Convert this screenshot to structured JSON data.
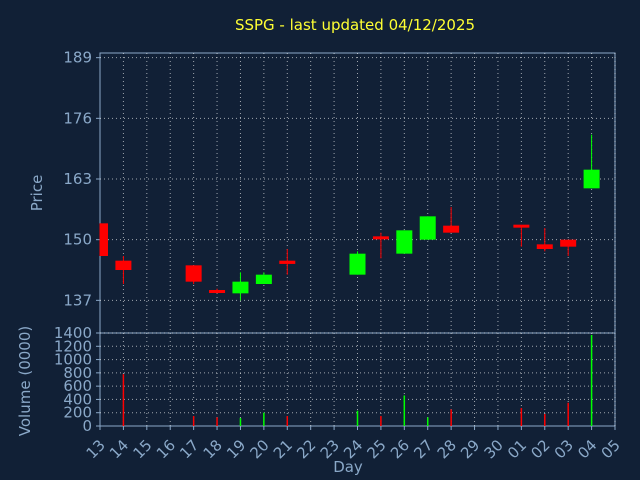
{
  "chart_data": {
    "type": "candlestick",
    "title": "SSPG - last updated 04/12/2025",
    "xlabel": "Day",
    "ylabel": "Price",
    "volume_label": "Volume (0000)",
    "price_ylim": [
      130,
      190
    ],
    "price_ticks": [
      137,
      150,
      163,
      176,
      189
    ],
    "volume_ylim": [
      0,
      1400
    ],
    "volume_ticks": [
      0,
      200,
      400,
      600,
      800,
      1000,
      1200,
      1400
    ],
    "x_ticks": [
      "13",
      "14",
      "15",
      "16",
      "17",
      "18",
      "19",
      "20",
      "21",
      "22",
      "23",
      "24",
      "25",
      "26",
      "27",
      "28",
      "29",
      "30",
      "01",
      "02",
      "03",
      "04",
      "05"
    ],
    "grid": true,
    "colors": {
      "background": "#112036",
      "title": "#ffff33",
      "axis_text": "#8aa8c8",
      "grid": "#ffffff",
      "up": "#00ff00",
      "down": "#ff0000"
    },
    "candles": [
      {
        "day": "13",
        "open": 153.5,
        "high": 153.5,
        "low": 146.5,
        "close": 146.5
      },
      {
        "day": "14",
        "open": 145.5,
        "high": 146.5,
        "low": 140.5,
        "close": 143.5
      },
      {
        "day": "17",
        "open": 144.5,
        "high": 144.5,
        "low": 140.5,
        "close": 141.0
      },
      {
        "day": "18",
        "open": 139.0,
        "high": 139.5,
        "low": 138.5,
        "close": 138.8
      },
      {
        "day": "19",
        "open": 138.5,
        "high": 143.0,
        "low": 137.0,
        "close": 141.0
      },
      {
        "day": "20",
        "open": 140.5,
        "high": 143.0,
        "low": 140.5,
        "close": 142.5
      },
      {
        "day": "21",
        "open": 145.5,
        "high": 148.0,
        "low": 142.5,
        "close": 144.8
      },
      {
        "day": "24",
        "open": 142.5,
        "high": 147.5,
        "low": 142.5,
        "close": 147.0
      },
      {
        "day": "25",
        "open": 150.5,
        "high": 151.5,
        "low": 146.0,
        "close": 150.0
      },
      {
        "day": "26",
        "open": 147.0,
        "high": 152.0,
        "low": 147.0,
        "close": 152.0
      },
      {
        "day": "27",
        "open": 150.0,
        "high": 155.0,
        "low": 150.0,
        "close": 155.0
      },
      {
        "day": "28",
        "open": 153.0,
        "high": 157.0,
        "low": 151.5,
        "close": 151.5
      },
      {
        "day": "01",
        "open": 153.0,
        "high": 153.0,
        "low": 148.5,
        "close": 152.5
      },
      {
        "day": "02",
        "open": 149.0,
        "high": 152.5,
        "low": 147.5,
        "close": 148.0
      },
      {
        "day": "03",
        "open": 150.0,
        "high": 150.0,
        "low": 146.5,
        "close": 148.5
      },
      {
        "day": "04",
        "open": 161.0,
        "high": 172.5,
        "low": 161.0,
        "close": 165.0
      }
    ],
    "volume": [
      {
        "day": "13",
        "value": 0
      },
      {
        "day": "14",
        "value": 780
      },
      {
        "day": "17",
        "value": 150
      },
      {
        "day": "18",
        "value": 130
      },
      {
        "day": "19",
        "value": 120
      },
      {
        "day": "20",
        "value": 200
      },
      {
        "day": "21",
        "value": 150
      },
      {
        "day": "24",
        "value": 230
      },
      {
        "day": "25",
        "value": 150
      },
      {
        "day": "26",
        "value": 460
      },
      {
        "day": "27",
        "value": 130
      },
      {
        "day": "28",
        "value": 250
      },
      {
        "day": "01",
        "value": 270
      },
      {
        "day": "02",
        "value": 180
      },
      {
        "day": "03",
        "value": 350
      },
      {
        "day": "04",
        "value": 1370
      }
    ]
  }
}
